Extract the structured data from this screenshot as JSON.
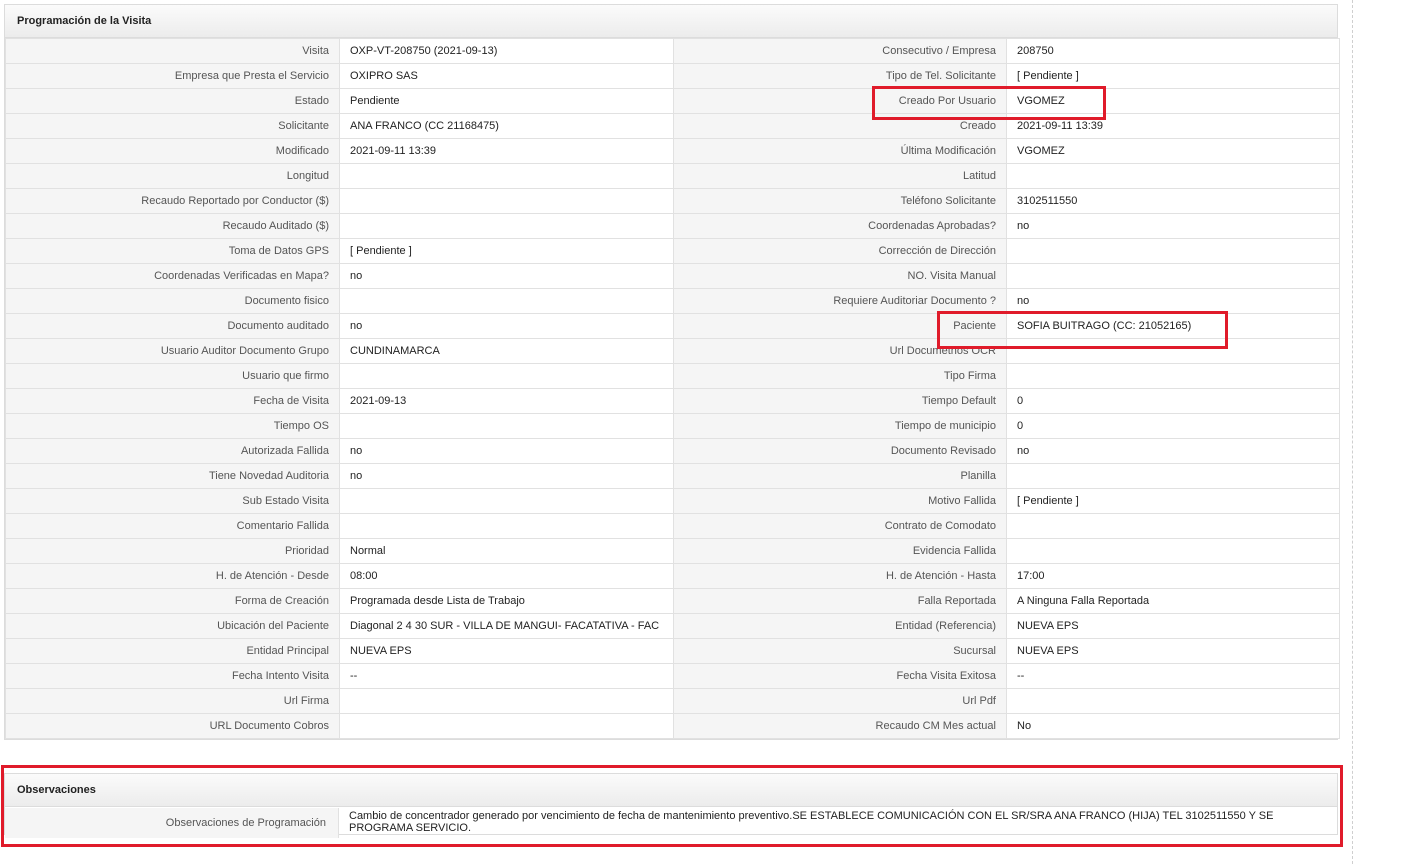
{
  "programacion": {
    "title": "Programación de la Visita",
    "rows": [
      [
        "Visita",
        "OXP-VT-208750 (2021-09-13)",
        "Consecutivo / Empresa",
        "208750"
      ],
      [
        "Empresa que Presta el Servicio",
        "OXIPRO SAS",
        "Tipo de Tel. Solicitante",
        "[ Pendiente ]"
      ],
      [
        "Estado",
        "Pendiente",
        "Creado Por Usuario",
        "VGOMEZ"
      ],
      [
        "Solicitante",
        "ANA FRANCO (CC 21168475)",
        "Creado",
        "2021-09-11 13:39"
      ],
      [
        "Modificado",
        "2021-09-11 13:39",
        "Última Modificación",
        " VGOMEZ"
      ],
      [
        "Longitud",
        "",
        "Latitud",
        ""
      ],
      [
        "Recaudo Reportado por Conductor ($)",
        "",
        "Teléfono Solicitante",
        "3102511550"
      ],
      [
        "Recaudo Auditado ($)",
        "",
        "Coordenadas Aprobadas?",
        " no"
      ],
      [
        "Toma de Datos GPS",
        "[ Pendiente ]",
        "Corrección de Dirección",
        ""
      ],
      [
        "Coordenadas Verificadas en Mapa?",
        " no",
        "NO. Visita Manual",
        ""
      ],
      [
        "Documento fisico",
        "",
        "Requiere Auditoriar Documento ?",
        " no"
      ],
      [
        "Documento auditado",
        " no",
        "Paciente",
        "SOFIA BUITRAGO (CC: 21052165)"
      ],
      [
        "Usuario Auditor Documento Grupo",
        "CUNDINAMARCA",
        "Url Documetnos OCR",
        ""
      ],
      [
        "Usuario que firmo",
        "",
        "Tipo Firma",
        ""
      ],
      [
        "Fecha de Visita",
        " 2021-09-13",
        "Tiempo Default",
        "0"
      ],
      [
        "Tiempo OS",
        "",
        "Tiempo de municipio",
        "0"
      ],
      [
        "Autorizada Fallida",
        " no",
        "Documento Revisado",
        " no"
      ],
      [
        "Tiene Novedad Auditoria",
        " no",
        "Planilla",
        ""
      ],
      [
        "Sub Estado Visita",
        "",
        "Motivo Fallida",
        "[ Pendiente ]"
      ],
      [
        "Comentario Fallida",
        "",
        "Contrato de Comodato",
        ""
      ],
      [
        "Prioridad",
        "Normal",
        "Evidencia Fallida",
        ""
      ],
      [
        "H. de Atención - Desde",
        "08:00",
        "H. de Atención - Hasta",
        "17:00"
      ],
      [
        "Forma de Creación",
        "Programada desde Lista de Trabajo",
        "Falla Reportada",
        "A Ninguna Falla Reportada"
      ],
      [
        "Ubicación del Paciente",
        "Diagonal 2 4 30 SUR - VILLA DE MANGUI- FACATATIVA - FAC",
        "Entidad (Referencia)",
        "NUEVA EPS"
      ],
      [
        "Entidad Principal",
        "NUEVA EPS",
        "Sucursal",
        "NUEVA EPS"
      ],
      [
        "Fecha Intento Visita",
        " --",
        "Fecha Visita Exitosa",
        " --"
      ],
      [
        "Url Firma",
        "",
        "Url Pdf",
        ""
      ],
      [
        "URL Documento Cobros",
        "",
        "Recaudo CM Mes actual",
        "No"
      ]
    ]
  },
  "observaciones": {
    "title": "Observaciones",
    "label": "Observaciones de Programación",
    "value": "Cambio de concentrador generado por vencimiento de fecha de mantenimiento preventivo.SE ESTABLECE COMUNICACIÓN CON EL SR/SRA ANA FRANCO (HIJA) TEL 3102511550 Y SE PROGRAMA SERVICIO."
  },
  "colors": {
    "highlight": "#e01b2a",
    "label_bg": "#f5f5f5",
    "border": "#e1e1e1"
  }
}
